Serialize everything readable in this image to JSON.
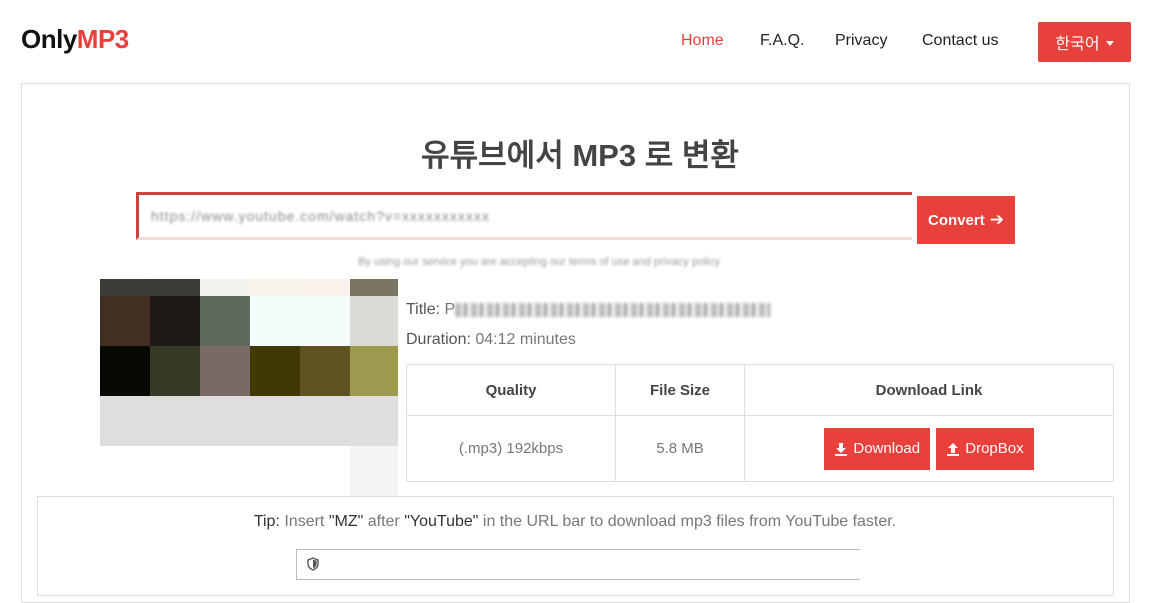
{
  "logo": {
    "prefix": "Only",
    "accent": "MP3"
  },
  "nav": {
    "home": "Home",
    "faq": "F.A.Q.",
    "privacy": "Privacy",
    "contact": "Contact us",
    "language": "한국어"
  },
  "heading": "유튜브에서 MP3 로 변환",
  "url_input": {
    "value": "https://www.youtube.com/watch?v=xxxxxxxxxxx"
  },
  "convert": {
    "label": "Convert"
  },
  "hint": "By using our service you are accepting our terms of use and privacy policy",
  "video": {
    "title_label": "Title:",
    "title_value": "P",
    "duration_label": "Duration:",
    "duration_value": "04:12 minutes"
  },
  "table": {
    "headers": [
      "Quality",
      "File Size",
      "Download Link"
    ],
    "rows": [
      {
        "quality": "(.mp3) 192kbps",
        "size": "5.8 MB"
      }
    ],
    "download_label": "Download",
    "dropbox_label": "DropBox"
  },
  "tip": {
    "label": "Tip:",
    "part1": "Insert",
    "mz": "\"MZ\"",
    "part2": "after",
    "youtube": "\"YouTube\"",
    "part3": "in the URL bar to download mp3 files from YouTube faster."
  },
  "colors": {
    "accent": "#e8403a",
    "border": "#dddddd"
  },
  "icons": [
    "download-icon",
    "upload-icon",
    "arrow-right-icon",
    "caret-down-icon",
    "shield-icon"
  ]
}
